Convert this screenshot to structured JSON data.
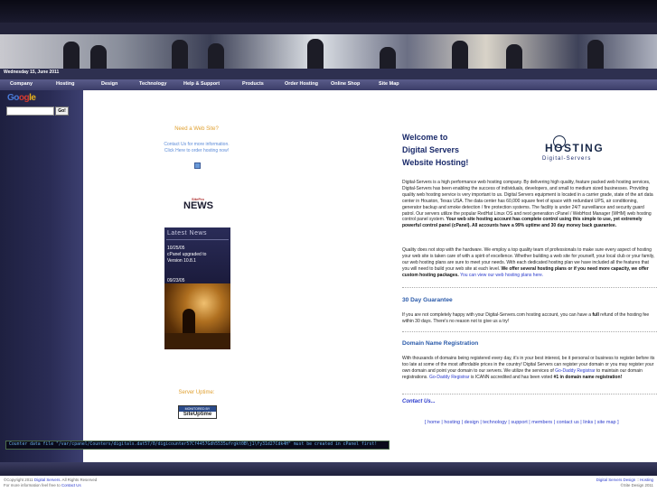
{
  "date": "Wednesday 15, June 2011",
  "nav": [
    "Company",
    "Hosting",
    "Design",
    "Technology",
    "Help & Support",
    "Products",
    "Order Hosting",
    "Online Shop",
    "Site Map"
  ],
  "search": {
    "logo_letters": [
      "Go",
      "og",
      "le"
    ],
    "button": "Go!",
    "value": ""
  },
  "promo": {
    "title": "Need a Web Site?",
    "line1": "Contact Us for more information.",
    "line2": "Click Here to order hosting now!"
  },
  "sitepro_logo": {
    "small": "SitePro",
    "big": "NEWS"
  },
  "news": {
    "heading": "Latest News",
    "items": [
      {
        "date": "10/25/05",
        "text1": "cPanel upgraded to",
        "text2": "Version 10.8.1"
      },
      {
        "date": "09/23/05"
      }
    ]
  },
  "server_uptime": "Server Uptime:",
  "siteuptime_badge": {
    "top": "MONITORED BY",
    "bottom": "SiteUptime"
  },
  "welcome": [
    "Welcome to",
    "Digital Servers",
    "Website Hosting!"
  ],
  "hosting_logo": {
    "word": "HOSTING",
    "sub": "Digital-Servers"
  },
  "intro_paragraph": {
    "plain1": "Digital-Servers is a high performance web hosting company. By delivering high quality, feature packed web hosting services, Digital-Servers has been enabling the success of individuals, developers, and small to medium sized businesses. Providing quality web hosting service is very important to us. Digital Servers equipment is located in a carrier grade, state of the art data center in Houston, Texas USA. The data center has 60,000 square feet of space with redundant UPS, air conditioning, generator backup and smoke detection / fire protection systems. The facility is under 24/7 surveillance and security guard patrol. Our servers utilize the popular RedHat Linux OS and next generation cPanel / WebHost Manager (WHM) web hosting control panel system. ",
    "bold1": "Your web site hosting account has complete control using this simple to use, yet extremely powerful control panel (cPanel). All accounts have a 99% uptime and 30 day money back guarantee."
  },
  "quality_paragraph": {
    "plain1": "Quality does not stop with the hardware. We employ a top quality team of professionals to make sure every aspect of hosting your web site is taken care of with a spirit of excellence. Whether building a web site for yourself, your local club or your family, our web hosting plans are sure to meet your needs. With each dedicated hosting plan we have included all the features that you will need to build your web site at each level. ",
    "bold1": "We offer several hosting plans or if you need more capacity, we offer custom hosting packages.",
    "link1": "You can view our web hosting plans here."
  },
  "guarantee": {
    "heading": "30 Day Guarantee",
    "plain1": "If you are not completely happy with your Digital-Servers.com hosting account, you can have a ",
    "bold1": "full",
    "plain2": " refund of the hosting fee within 30 days. There's no reason not to give us a try!"
  },
  "domain": {
    "heading": "Domain Name Registration",
    "plain1": "With thousands of domains being registered every day, it's in your best interest, be it personal or business to register before its too late at some of the most affordable prices in the country! Digital Servers can register your domain or you may register your own domain and point your domain to our servers. We utilize the services of ",
    "link1": "Go-Daddy Registrar",
    "plain2": " to maintain our domain registrations. ",
    "link2": "Go-Daddy Registrar",
    "plain3": " is ICANN accredited and has been voted ",
    "bold1": "#1 in domain name registration!"
  },
  "contact_us": "Contact Us...",
  "bottom_links": [
    "home",
    "hosting",
    "design",
    "technology",
    "support",
    "members",
    "contact us",
    "links",
    "site map"
  ],
  "counter_text": "Counter data file \"/var/cpanel/Counters/digitals.dat57/0/digicounter57Cf4457Gdh5535ufrgkt0B\\j1\\fy31d27Cdk4H\" must be created in cPanel first!",
  "footer": {
    "left1_plain": "©Copyright 2011 ",
    "left1_link": "Digital Servers",
    "left1_tail": ". All Rights Reserved",
    "left2_plain": "For more information feel free to ",
    "left2_link": "Contact Us",
    "right1_link1": "Digital Servers Design",
    "right1_sep": " :: ",
    "right1_link2": "Hosting",
    "right2": "©Site Design 2011"
  },
  "colors": {
    "nav_bg": "#3b3d68",
    "sidebar": "#2a2c55",
    "accent_orange": "#e0a030",
    "heading_blue": "#2a5aaa",
    "link_blue": "#2a3acc"
  }
}
